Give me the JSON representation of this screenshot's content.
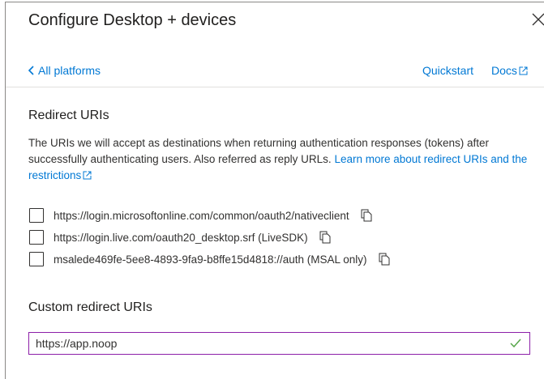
{
  "panel": {
    "title": "Configure Desktop + devices"
  },
  "nav": {
    "back_label": "All platforms",
    "quickstart_label": "Quickstart",
    "docs_label": "Docs"
  },
  "redirect": {
    "heading": "Redirect URIs",
    "description": "The URIs we will accept as destinations when returning authentication responses (tokens) after successfully authenticating users. Also referred as reply URLs.",
    "learn_more_label": "Learn more about redirect URIs and the restrictions",
    "uris": [
      {
        "label": "https://login.microsoftonline.com/common/oauth2/nativeclient",
        "checked": false
      },
      {
        "label": "https://login.live.com/oauth20_desktop.srf (LiveSDK)",
        "checked": false
      },
      {
        "label": "msalede469fe-5ee8-4893-9fa9-b8ffe15d4818://auth (MSAL only)",
        "checked": false
      }
    ]
  },
  "custom": {
    "heading": "Custom redirect URIs",
    "value": "https://app.noop",
    "valid": true
  },
  "colors": {
    "link": "#0078d4",
    "input_border": "#8c1fa8",
    "valid_check": "#57a64a"
  }
}
